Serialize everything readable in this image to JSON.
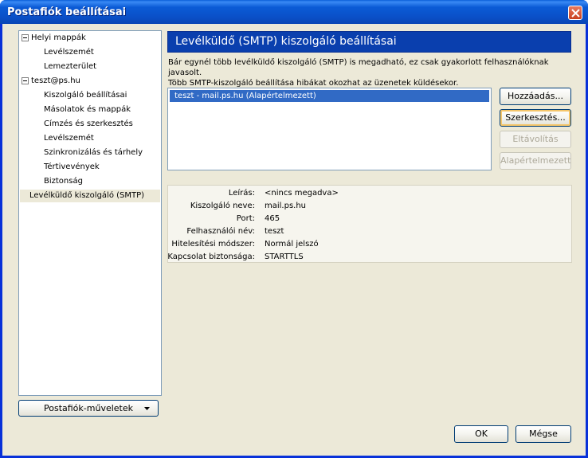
{
  "window": {
    "title": "Postafiók beállításai"
  },
  "tree": {
    "items": [
      {
        "label": "Helyi mappák",
        "expandable": true
      },
      {
        "label": "Levélszemét"
      },
      {
        "label": "Lemezterület"
      },
      {
        "label": "teszt@ps.hu",
        "expandable": true
      },
      {
        "label": "Kiszolgáló beállításai"
      },
      {
        "label": "Másolatok és mappák"
      },
      {
        "label": "Címzés és szerkesztés"
      },
      {
        "label": "Levélszemét"
      },
      {
        "label": "Szinkronizálás és tárhely"
      },
      {
        "label": "Tértivevények"
      },
      {
        "label": "Biztonság"
      },
      {
        "label": "Levélküldő kiszolgáló (SMTP)",
        "selected": true
      }
    ],
    "actions_button": "Postafiók-műveletek"
  },
  "panel": {
    "title": "Levélküldő (SMTP) kiszolgáló beállításai",
    "description_line1": "Bár egynél több levélküldő kiszolgáló (SMTP) is megadható, ez csak gyakorlott felhasználóknak javasolt.",
    "description_line2": "Több SMTP-kiszolgáló beállítása hibákat okozhat az üzenetek küldésekor.",
    "servers": [
      "teszt - mail.ps.hu (Alapértelmezett)"
    ],
    "buttons": {
      "add": "Hozzáadás...",
      "edit": "Szerkesztés...",
      "remove": "Eltávolítás",
      "set_default": "Alapértelmezett"
    },
    "details": [
      {
        "label": "Leírás:",
        "value": "<nincs megadva>"
      },
      {
        "label": "Kiszolgáló neve:",
        "value": "mail.ps.hu"
      },
      {
        "label": "Port:",
        "value": "465"
      },
      {
        "label": "Felhasználói név:",
        "value": "teszt"
      },
      {
        "label": "Hitelesítési módszer:",
        "value": "Normál jelszó"
      },
      {
        "label": "Kapcsolat biztonsága:",
        "value": "STARTTLS"
      }
    ]
  },
  "footer": {
    "ok": "OK",
    "cancel": "Mégse"
  },
  "colors": {
    "titlebar": "#0a5fd8",
    "header": "#0a3fae",
    "selection": "#316ac5"
  }
}
